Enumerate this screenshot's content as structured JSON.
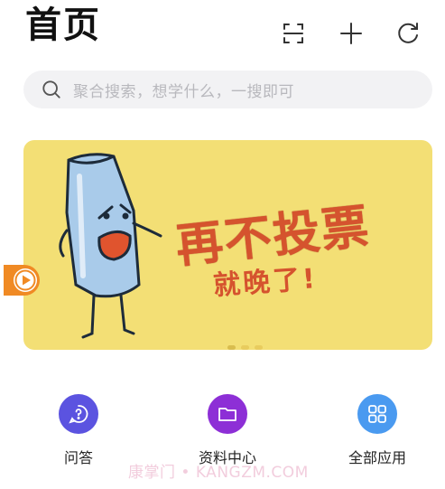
{
  "header": {
    "title": "首页",
    "actions": [
      {
        "icon": "scan-icon"
      },
      {
        "icon": "plus-icon"
      },
      {
        "icon": "refresh-icon"
      }
    ]
  },
  "search": {
    "placeholder": "聚合搜索，想学什么，一搜即可",
    "icon": "search-icon"
  },
  "banner": {
    "headline": "再不投票",
    "subline": "就晚了!",
    "background": "#f3df75",
    "text_color": "#d5532e",
    "dots": 3
  },
  "floating": {
    "icon": "play-icon",
    "color": "#f08a24"
  },
  "shortcuts": [
    {
      "label": "问答",
      "icon": "question-chat-icon",
      "color": "#5b53e0"
    },
    {
      "label": "资料中心",
      "icon": "folder-icon",
      "color": "#8d2fd6"
    },
    {
      "label": "全部应用",
      "icon": "grid-apps-icon",
      "color": "#4a9af0"
    }
  ],
  "watermark": "康掌门 • KANGZM.COM"
}
